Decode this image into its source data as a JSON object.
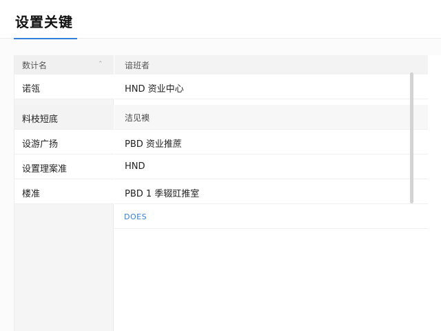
{
  "header": {
    "title": "设置关键"
  },
  "left_panel": {
    "header_label": "数计名",
    "items": [
      {
        "label": "诺瓴",
        "kind": "item"
      },
      {
        "label": "料枝短底",
        "kind": "group"
      },
      {
        "label": "设游广扬",
        "kind": "item"
      },
      {
        "label": "设置理案准",
        "kind": "item"
      },
      {
        "label": "楼准",
        "kind": "item"
      }
    ]
  },
  "right_panel": {
    "rows": [
      {
        "label": "谙班者",
        "kind": "head"
      },
      {
        "label": "HND 资业中心",
        "kind": "item"
      },
      {
        "label": "洁见襖",
        "kind": "group"
      },
      {
        "label": "PBD 资业推蔗",
        "kind": "item"
      },
      {
        "label": "HND",
        "kind": "item"
      },
      {
        "label": "PBD 1  季辍豇推室",
        "kind": "item"
      }
    ],
    "link_label": "DOES"
  }
}
